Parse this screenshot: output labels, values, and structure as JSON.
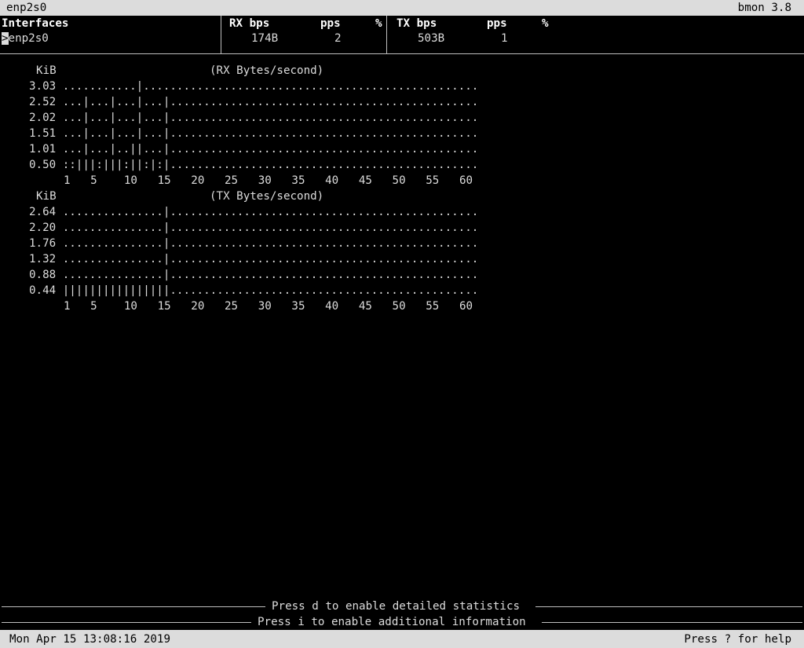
{
  "window": {
    "interface_title": "enp2s0",
    "app_version": "bmon 3.8"
  },
  "table": {
    "headers": {
      "interfaces": "Interfaces",
      "rx_bps": "RX bps",
      "rx_pps": "pps",
      "rx_pct": "%",
      "tx_bps": "TX bps",
      "tx_pps": "pps",
      "tx_pct": "%"
    },
    "row": {
      "selector": ">",
      "name": "enp2s0",
      "rx_bps": "174B",
      "rx_pps": "2",
      "tx_bps": "503B",
      "tx_pps": "1"
    }
  },
  "rx_graph": {
    "unit": "KiB",
    "title": "(RX Bytes/second)",
    "rows": [
      {
        "label": "3.03",
        "plot": "...........|.................................................."
      },
      {
        "label": "2.52",
        "plot": "...|...|...|...|.............................................."
      },
      {
        "label": "2.02",
        "plot": "...|...|...|...|.............................................."
      },
      {
        "label": "1.51",
        "plot": "...|...|...|...|.............................................."
      },
      {
        "label": "1.01",
        "plot": "...|...|..||...|.............................................."
      },
      {
        "label": "0.50",
        "plot": "::|||:|||:||:|:|.............................................."
      }
    ],
    "x_ticks": "1   5    10   15   20   25   30   35   40   45   50   55   60"
  },
  "tx_graph": {
    "unit": "KiB",
    "title": "(TX Bytes/second)",
    "rows": [
      {
        "label": "2.64",
        "plot": "...............|.............................................."
      },
      {
        "label": "2.20",
        "plot": "...............|.............................................."
      },
      {
        "label": "1.76",
        "plot": "...............|.............................................."
      },
      {
        "label": "1.32",
        "plot": "...............|.............................................."
      },
      {
        "label": "0.88",
        "plot": "...............|.............................................."
      },
      {
        "label": "0.44",
        "plot": "||||||||||||||||.............................................."
      }
    ],
    "x_ticks": "1   5    10   15   20   25   30   35   40   45   50   55   60"
  },
  "hints": {
    "detailed": "Press d to enable detailed statistics",
    "additional": "Press i to enable additional information"
  },
  "status": {
    "datetime": "Mon Apr 15 13:08:16 2019",
    "help": "Press ? for help"
  }
}
